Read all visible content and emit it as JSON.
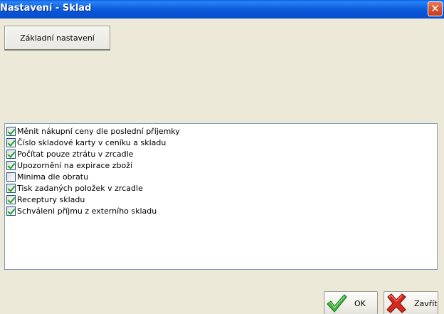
{
  "window": {
    "title": "Nastavení - Sklad"
  },
  "tabs": [
    {
      "label": "Základní nastavení"
    }
  ],
  "options": [
    {
      "label": "Měnit nákupní ceny dle poslední příjemky",
      "checked": true
    },
    {
      "label": "Číslo skladové karty v ceníku a skladu",
      "checked": true
    },
    {
      "label": "Počítat pouze ztrátu v zrcadle",
      "checked": true
    },
    {
      "label": "Upozornění na expirace zboží",
      "checked": true
    },
    {
      "label": "Minima dle obratu",
      "checked": false
    },
    {
      "label": "Tisk zadaných položek v zrcadle",
      "checked": true
    },
    {
      "label": "Receptury skladu",
      "checked": true
    },
    {
      "label": "Schváleni příjmu z externího skladu",
      "checked": true
    }
  ],
  "buttons": {
    "ok_label": "OK",
    "close_label": "Zavřít"
  },
  "icons": {
    "close": "close-icon",
    "ok": "checkmark-icon",
    "cancel": "red-x-icon"
  },
  "colors": {
    "titlebar": "#0a5ee0",
    "check": "#21a121",
    "cancel": "#d42a1e"
  }
}
